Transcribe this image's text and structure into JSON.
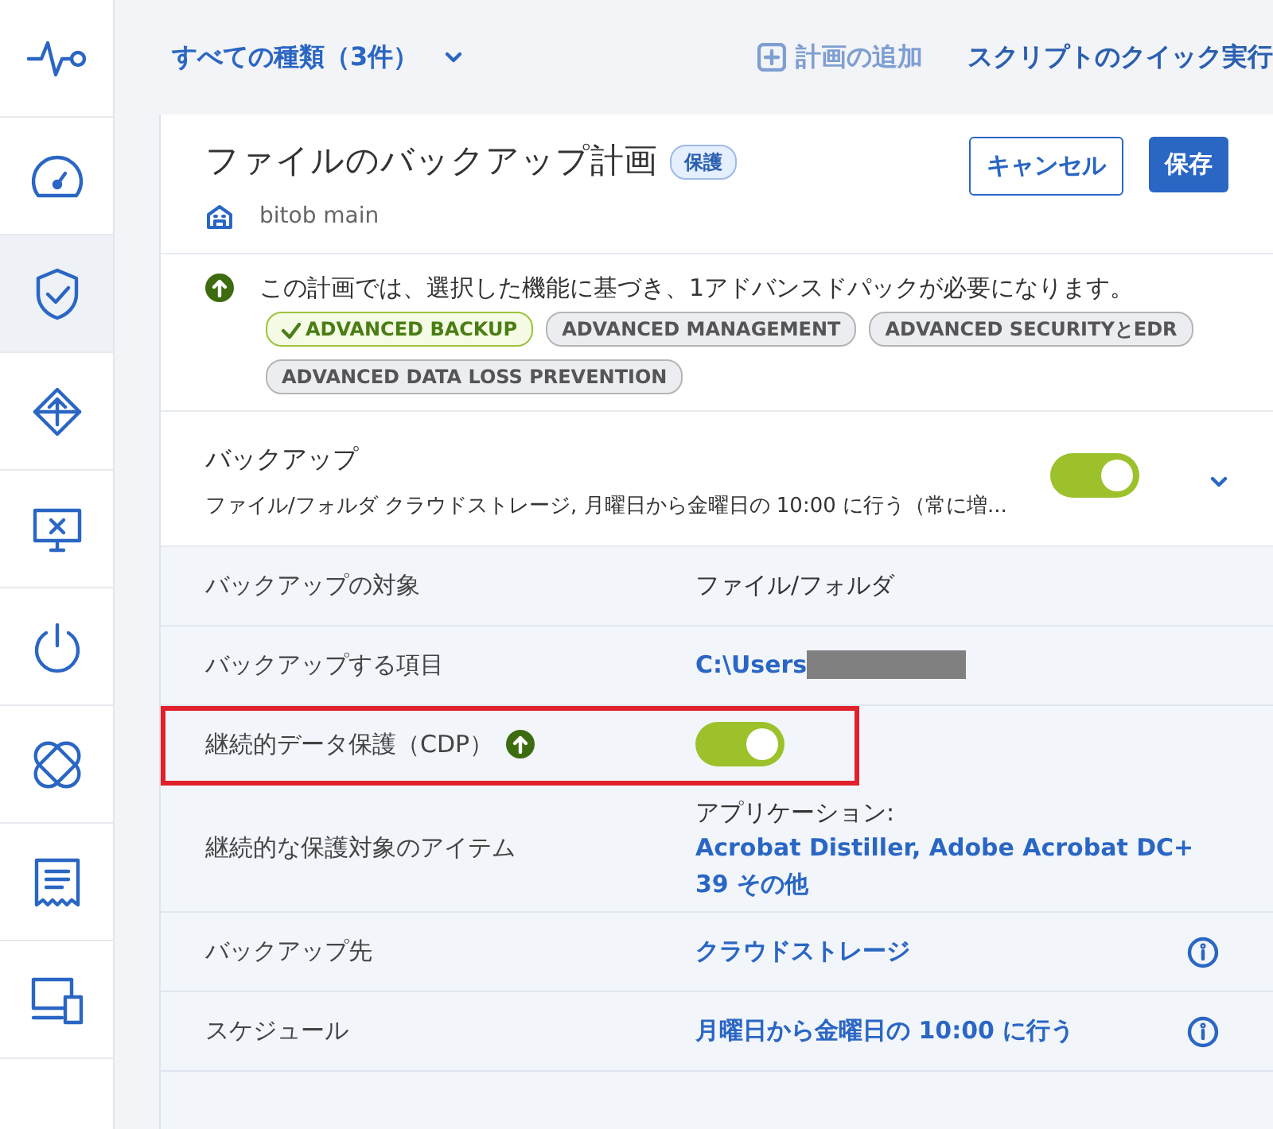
{
  "sidebar": {
    "items": [
      {
        "kind": "pulse",
        "selected": false
      },
      {
        "kind": "gauge",
        "selected": false
      },
      {
        "kind": "shield",
        "selected": true
      },
      {
        "kind": "arrows",
        "selected": false
      },
      {
        "kind": "monitor",
        "selected": false
      },
      {
        "kind": "power",
        "selected": false
      },
      {
        "kind": "bandage",
        "selected": false
      },
      {
        "kind": "report",
        "selected": false
      },
      {
        "kind": "devices",
        "selected": false
      }
    ]
  },
  "toolbar": {
    "filter": "すべての種類（3件）",
    "add_plan": {
      "label": "計画の追加",
      "disabled": true
    },
    "quick_script": "スクリプトのクイック実行"
  },
  "plan": {
    "title": "ファイルのバックアップ計画",
    "badge": "保護",
    "location": "bitob main",
    "cancel": "キャンセル",
    "save": "保存"
  },
  "notice": {
    "text": "この計画では、選択した機能に基づき、1アドバンスドパックが必要になります。",
    "tags": [
      {
        "label": "ADVANCED BACKUP",
        "included": true
      },
      {
        "label": "ADVANCED MANAGEMENT",
        "included": false
      },
      {
        "label": "ADVANCED SECURITYとEDR",
        "included": false
      },
      {
        "label": "ADVANCED DATA LOSS PREVENTION",
        "included": false
      }
    ]
  },
  "backup": {
    "title": "バックアップ",
    "summary": "ファイル/フォルダ クラウドストレージ, 月曜日から金曜日の 10:00 に行う（常に増...",
    "on": true
  },
  "rows": [
    {
      "kind": "text",
      "label": "バックアップの対象",
      "value": "ファイル/フォルダ"
    },
    {
      "kind": "path",
      "label": "バックアップする項目",
      "value": "C:\\Users"
    },
    {
      "kind": "toggle",
      "label": "継続的データ保護（CDP）",
      "on": true,
      "highlighted": true
    },
    {
      "kind": "apps",
      "label": "継続的な保護対象のアイテム",
      "caption": "アプリケーション:",
      "value": "Acrobat Distiller, Adobe Acrobat DC+ 39 その他"
    },
    {
      "kind": "link",
      "label": "バックアップ先",
      "value": "クラウドストレージ",
      "info": true
    },
    {
      "kind": "link",
      "label": "スケジュール",
      "value": "月曜日から金曜日の 10:00 に行う",
      "info": true
    }
  ]
}
